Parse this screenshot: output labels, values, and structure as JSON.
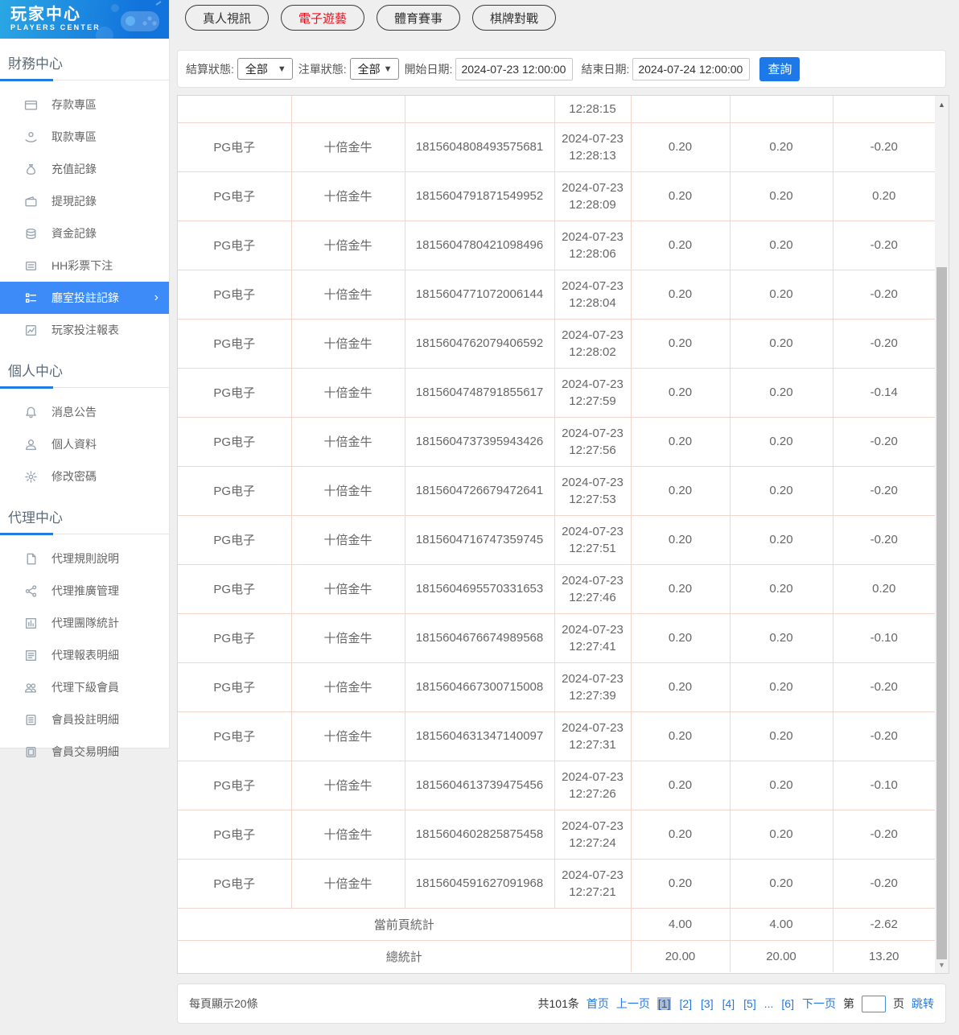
{
  "logo": {
    "title": "玩家中心",
    "subtitle": "PLAYERS CENTER"
  },
  "sidebar": {
    "sections": [
      {
        "title": "財務中心",
        "items": [
          {
            "label": "存款專區",
            "icon": "deposit-icon"
          },
          {
            "label": "取款專區",
            "icon": "withdraw-icon"
          },
          {
            "label": "充值記錄",
            "icon": "recharge-icon"
          },
          {
            "label": "提現記錄",
            "icon": "cashout-icon"
          },
          {
            "label": "資金記錄",
            "icon": "funds-icon"
          },
          {
            "label": "HH彩票下注",
            "icon": "lottery-icon"
          },
          {
            "label": "廳室投註記錄",
            "icon": "bet-records-icon",
            "selected": true,
            "arrow": "›"
          },
          {
            "label": "玩家投注報表",
            "icon": "report-icon"
          }
        ]
      },
      {
        "title": "個人中心",
        "items": [
          {
            "label": "消息公告",
            "icon": "bell-icon"
          },
          {
            "label": "個人資料",
            "icon": "profile-icon"
          },
          {
            "label": "修改密碼",
            "icon": "gear-icon"
          }
        ]
      },
      {
        "title": "代理中心",
        "items": [
          {
            "label": "代理規則說明",
            "icon": "doc-icon"
          },
          {
            "label": "代理推廣管理",
            "icon": "share-icon"
          },
          {
            "label": "代理團隊統計",
            "icon": "team-stats-icon"
          },
          {
            "label": "代理報表明細",
            "icon": "report-detail-icon"
          },
          {
            "label": "代理下級會員",
            "icon": "members-icon"
          },
          {
            "label": "會員投註明細",
            "icon": "member-bets-icon"
          },
          {
            "label": "會員交易明細",
            "icon": "member-trades-icon"
          }
        ]
      }
    ]
  },
  "tabs": [
    {
      "label": "真人視訊",
      "active": false
    },
    {
      "label": "電子遊藝",
      "active": true
    },
    {
      "label": "體育賽事",
      "active": false
    },
    {
      "label": "棋牌對戰",
      "active": false
    }
  ],
  "filters": {
    "settle_status_label": "結算狀態:",
    "settle_status_value": "全部",
    "order_status_label": "注單狀態:",
    "order_status_value": "全部",
    "start_date_label": "開始日期:",
    "start_date_value": "2024-07-23 12:00:00",
    "end_date_label": "結束日期:",
    "end_date_value": "2024-07-24 12:00:00",
    "search_label": "查詢"
  },
  "table": {
    "partial_row_time": "12:28:15",
    "rows": [
      {
        "platform": "PG电子",
        "game": "十倍金牛",
        "order_no": "1815604808493575681",
        "date": "2024-07-23",
        "time": "12:28:13",
        "bet": "0.20",
        "valid_bet": "0.20",
        "win_loss": "-0.20"
      },
      {
        "platform": "PG电子",
        "game": "十倍金牛",
        "order_no": "1815604791871549952",
        "date": "2024-07-23",
        "time": "12:28:09",
        "bet": "0.20",
        "valid_bet": "0.20",
        "win_loss": "0.20"
      },
      {
        "platform": "PG电子",
        "game": "十倍金牛",
        "order_no": "1815604780421098496",
        "date": "2024-07-23",
        "time": "12:28:06",
        "bet": "0.20",
        "valid_bet": "0.20",
        "win_loss": "-0.20"
      },
      {
        "platform": "PG电子",
        "game": "十倍金牛",
        "order_no": "1815604771072006144",
        "date": "2024-07-23",
        "time": "12:28:04",
        "bet": "0.20",
        "valid_bet": "0.20",
        "win_loss": "-0.20"
      },
      {
        "platform": "PG电子",
        "game": "十倍金牛",
        "order_no": "1815604762079406592",
        "date": "2024-07-23",
        "time": "12:28:02",
        "bet": "0.20",
        "valid_bet": "0.20",
        "win_loss": "-0.20"
      },
      {
        "platform": "PG电子",
        "game": "十倍金牛",
        "order_no": "1815604748791855617",
        "date": "2024-07-23",
        "time": "12:27:59",
        "bet": "0.20",
        "valid_bet": "0.20",
        "win_loss": "-0.14"
      },
      {
        "platform": "PG电子",
        "game": "十倍金牛",
        "order_no": "1815604737395943426",
        "date": "2024-07-23",
        "time": "12:27:56",
        "bet": "0.20",
        "valid_bet": "0.20",
        "win_loss": "-0.20"
      },
      {
        "platform": "PG电子",
        "game": "十倍金牛",
        "order_no": "1815604726679472641",
        "date": "2024-07-23",
        "time": "12:27:53",
        "bet": "0.20",
        "valid_bet": "0.20",
        "win_loss": "-0.20"
      },
      {
        "platform": "PG电子",
        "game": "十倍金牛",
        "order_no": "1815604716747359745",
        "date": "2024-07-23",
        "time": "12:27:51",
        "bet": "0.20",
        "valid_bet": "0.20",
        "win_loss": "-0.20"
      },
      {
        "platform": "PG电子",
        "game": "十倍金牛",
        "order_no": "1815604695570331653",
        "date": "2024-07-23",
        "time": "12:27:46",
        "bet": "0.20",
        "valid_bet": "0.20",
        "win_loss": "0.20"
      },
      {
        "platform": "PG电子",
        "game": "十倍金牛",
        "order_no": "1815604676674989568",
        "date": "2024-07-23",
        "time": "12:27:41",
        "bet": "0.20",
        "valid_bet": "0.20",
        "win_loss": "-0.10"
      },
      {
        "platform": "PG电子",
        "game": "十倍金牛",
        "order_no": "1815604667300715008",
        "date": "2024-07-23",
        "time": "12:27:39",
        "bet": "0.20",
        "valid_bet": "0.20",
        "win_loss": "-0.20"
      },
      {
        "platform": "PG电子",
        "game": "十倍金牛",
        "order_no": "1815604631347140097",
        "date": "2024-07-23",
        "time": "12:27:31",
        "bet": "0.20",
        "valid_bet": "0.20",
        "win_loss": "-0.20"
      },
      {
        "platform": "PG电子",
        "game": "十倍金牛",
        "order_no": "1815604613739475456",
        "date": "2024-07-23",
        "time": "12:27:26",
        "bet": "0.20",
        "valid_bet": "0.20",
        "win_loss": "-0.10"
      },
      {
        "platform": "PG电子",
        "game": "十倍金牛",
        "order_no": "1815604602825875458",
        "date": "2024-07-23",
        "time": "12:27:24",
        "bet": "0.20",
        "valid_bet": "0.20",
        "win_loss": "-0.20"
      },
      {
        "platform": "PG电子",
        "game": "十倍金牛",
        "order_no": "1815604591627091968",
        "date": "2024-07-23",
        "time": "12:27:21",
        "bet": "0.20",
        "valid_bet": "0.20",
        "win_loss": "-0.20"
      }
    ],
    "summaries": [
      {
        "label": "當前頁統計",
        "bet": "4.00",
        "valid_bet": "4.00",
        "win_loss": "-2.62"
      },
      {
        "label": "總統計",
        "bet": "20.00",
        "valid_bet": "20.00",
        "win_loss": "13.20"
      }
    ]
  },
  "pagination": {
    "page_size_text": "每頁顯示20條",
    "total_text": "共101条",
    "first": "首页",
    "prev": "上一页",
    "pages": [
      {
        "label": "[1]",
        "current": true
      },
      {
        "label": "[2]",
        "current": false
      },
      {
        "label": "[3]",
        "current": false
      },
      {
        "label": "[4]",
        "current": false
      },
      {
        "label": "[5]",
        "current": false
      },
      {
        "label": "...",
        "ellipsis": true
      },
      {
        "label": "[6]",
        "current": false
      }
    ],
    "next": "下一页",
    "jump_prefix": "第",
    "jump_suffix": "页",
    "jump_button": "跳转",
    "jump_value": ""
  },
  "colors": {
    "header_gradient_start": "#2aa7e4",
    "header_gradient_end": "#1273dd",
    "selected_item_bg": "#3d8bf8",
    "section_underline": "#1f7ce2",
    "active_tab_red": "#e8101c",
    "search_button_bg": "#1d79e8",
    "table_border": "#f2d6cd",
    "link_blue": "#2478e0"
  }
}
